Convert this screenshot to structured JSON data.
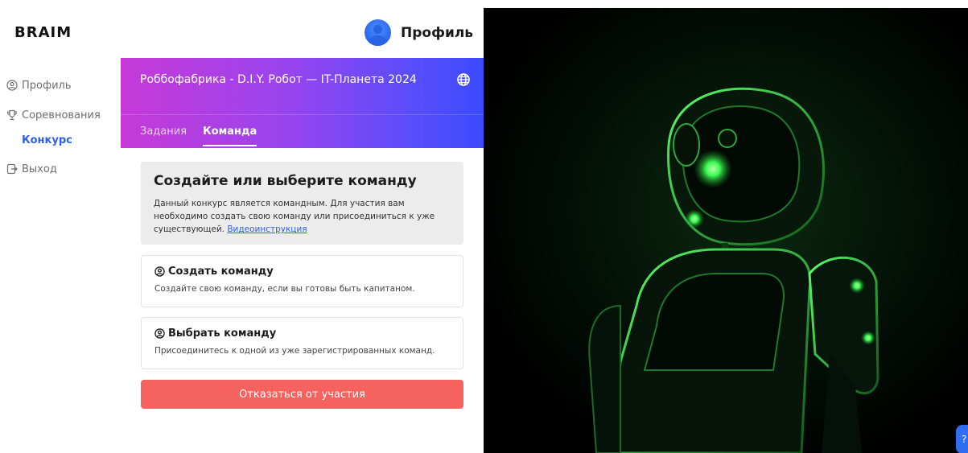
{
  "logo": {
    "text": "BRAIM"
  },
  "header": {
    "profile_label": "Профиль",
    "avatar_icon": "user-avatar-icon"
  },
  "sidebar": {
    "items": [
      {
        "label": "Профиль",
        "icon": "user-circle-icon"
      },
      {
        "label": "Соревнования",
        "icon": "trophy-icon"
      },
      {
        "label": "Конкурс"
      },
      {
        "label": "Выход",
        "icon": "logout-icon"
      }
    ]
  },
  "banner": {
    "title": "Роббофабрика - D.I.Y. Робот — IT-Планета 2024",
    "globe_icon": "globe-icon",
    "tabs": [
      {
        "label": "Задания",
        "active": false
      },
      {
        "label": "Команда",
        "active": true
      }
    ]
  },
  "info": {
    "title": "Создайте или выберите команду",
    "text": "Данный конкурс является командным. Для участия вам необходимо создать свою команду или присоединиться к уже существующей.",
    "link": "Видеоинструкция"
  },
  "options": [
    {
      "title": "Создать команду",
      "desc": "Создайте свою команду, если вы готовы быть капитаном.",
      "icon": "user-circle-icon"
    },
    {
      "title": "Выбрать команду",
      "desc": "Присоединитесь к одной из уже зарегистрированных команд.",
      "icon": "user-circle-icon"
    }
  ],
  "decline_button": "Отказаться от участия",
  "help_button": "?",
  "colors": {
    "accent_blue": "#2f5fe3",
    "banner_gradient_start": "#c63ad8",
    "banner_gradient_end": "#3b4bff",
    "decline_red": "#f6635f",
    "robot_glow": "#3cff52"
  }
}
